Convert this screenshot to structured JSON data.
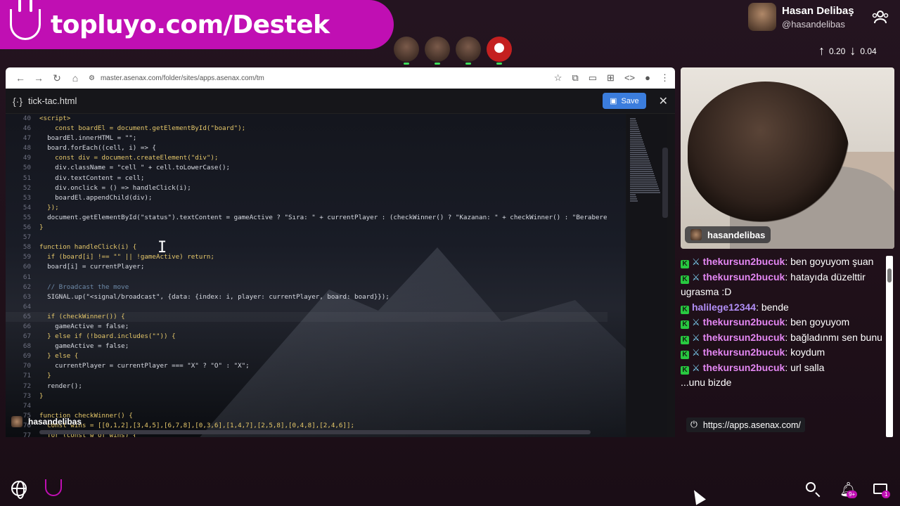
{
  "banner": {
    "text": "topluyo.com/Destek"
  },
  "profile": {
    "name": "Hasan Delibaş",
    "handle": "@hasandelibas",
    "up": "0.20",
    "down": "0.04"
  },
  "browser": {
    "url": "master.asenax.com/folder/sites/apps.asenax.com/tm",
    "file_name": "tick-tac.html",
    "save_label": "Save"
  },
  "code": [
    {
      "n": "46",
      "t": "    const boardEl = document.getElementById(\"board\");"
    },
    {
      "n": "47",
      "t": "  boardEl.innerHTML = \"\";"
    },
    {
      "n": "48",
      "t": "  board.forEach((cell, i) => {"
    },
    {
      "n": "49",
      "t": "    const div = document.createElement(\"div\");"
    },
    {
      "n": "50",
      "t": "    div.className = \"cell \" + cell.toLowerCase();"
    },
    {
      "n": "51",
      "t": "    div.textContent = cell;"
    },
    {
      "n": "52",
      "t": "    div.onclick = () => handleClick(i);"
    },
    {
      "n": "53",
      "t": "    boardEl.appendChild(div);"
    },
    {
      "n": "54",
      "t": "  });"
    },
    {
      "n": "55",
      "t": "  document.getElementById(\"status\").textContent = gameActive ? \"Sıra: \" + currentPlayer : (checkWinner() ? \"Kazanan: \" + checkWinner() : \"Berabere"
    },
    {
      "n": "56",
      "t": "}"
    },
    {
      "n": "57",
      "t": ""
    },
    {
      "n": "58",
      "t": "function handleClick(i) {"
    },
    {
      "n": "59",
      "t": "  if (board[i] !== \"\" || !gameActive) return;"
    },
    {
      "n": "60",
      "t": "  board[i] = currentPlayer;"
    },
    {
      "n": "61",
      "t": ""
    },
    {
      "n": "62",
      "t": "  // Broadcast the move"
    },
    {
      "n": "63",
      "t": "  SIGNAL.up(\"<signal/broadcast\", {data: {index: i, player: currentPlayer, board: board}});"
    },
    {
      "n": "64",
      "t": ""
    },
    {
      "n": "65",
      "t": "  if (checkWinner()) {"
    },
    {
      "n": "66",
      "t": "    gameActive = false;"
    },
    {
      "n": "67",
      "t": "  } else if (!board.includes(\"\")) {"
    },
    {
      "n": "68",
      "t": "    gameActive = false;"
    },
    {
      "n": "69",
      "t": "  } else {"
    },
    {
      "n": "70",
      "t": "    currentPlayer = currentPlayer === \"X\" ? \"O\" : \"X\";"
    },
    {
      "n": "71",
      "t": "  }"
    },
    {
      "n": "72",
      "t": "  render();"
    },
    {
      "n": "73",
      "t": "}"
    },
    {
      "n": "74",
      "t": ""
    },
    {
      "n": "75",
      "t": "function checkWinner() {"
    },
    {
      "n": "76",
      "t": "  const wins = [[0,1,2],[3,4,5],[6,7,8],[0,3,6],[1,4,7],[2,5,8],[0,4,8],[2,4,6]];"
    },
    {
      "n": "77",
      "t": "  for (const w of wins) {"
    }
  ],
  "code_top_line": "40",
  "code_top_text": "<script>",
  "overlay_user": "hasandelibas",
  "cam_tag": "hasandelibas",
  "chat": [
    {
      "user": "thekursun2bucuk",
      "text": "ben goyuyom şuan",
      "sword": true
    },
    {
      "user": "thekursun2bucuk",
      "text": "hatayıda düzelttir ugrasma :D",
      "sword": true
    },
    {
      "user": "halilege12344",
      "text": "bende",
      "sword": false
    },
    {
      "user": "thekursun2bucuk",
      "text": "ben goyuyom",
      "sword": true
    },
    {
      "user": "thekursun2bucuk",
      "text": "bağladınmı sen bunu",
      "sword": true
    },
    {
      "user": "thekursun2bucuk",
      "text": "koydum",
      "sword": true
    },
    {
      "user": "thekursun2bucuk",
      "text": "url salla",
      "sword": true
    },
    {
      "user": "",
      "text": "...unu bizde",
      "sword": false
    }
  ],
  "link_popup": "https://apps.asenax.com/",
  "notifications": {
    "bell": "9+",
    "mail": "1"
  },
  "colors": {
    "brand": "#c00fb3",
    "username": "#e386f2",
    "badge": "#28c840"
  }
}
